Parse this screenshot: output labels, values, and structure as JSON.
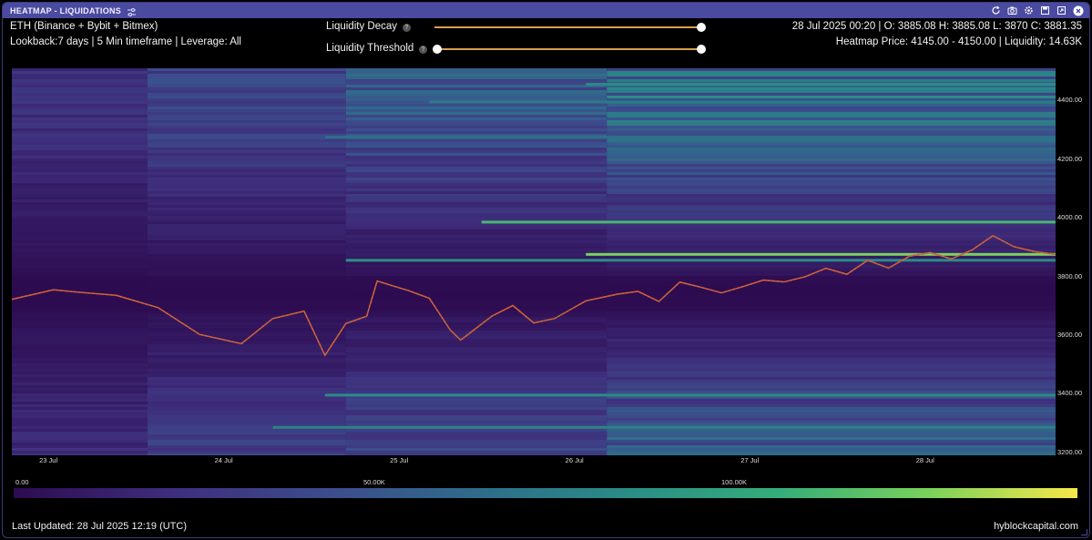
{
  "window": {
    "title": "HEATMAP - LIQUIDATIONS",
    "settings_icon": "sliders-icon",
    "toolbar_icons": [
      "refresh-icon",
      "camera-icon",
      "gear-icon",
      "save-icon",
      "expand-icon",
      "close-icon"
    ]
  },
  "info": {
    "exchanges": "ETH (Binance + Bybit + Bitmex)",
    "lookback": "Lookback:7 days | 5 Min timeframe | Leverage: All",
    "ohlc": "28 Jul 2025 00:20 | O: 3885.08 H: 3885.08 L: 3870 C: 3881.35",
    "heatmap_price": "Heatmap Price: 4145.00 - 4150.00 | Liquidity: 14.63K"
  },
  "controls": {
    "decay": {
      "label": "Liquidity Decay",
      "help": "?",
      "value": 1.0
    },
    "threshold": {
      "label": "Liquidity Threshold",
      "help": "?",
      "min": 0.0,
      "max": 1.0
    }
  },
  "chart_data": {
    "type": "heatmap",
    "y_ticks": [
      "4400.00",
      "4200.00",
      "4000.00",
      "3800.00",
      "3600.00",
      "3400.00",
      "3200.00"
    ],
    "x_ticks": [
      "23 Jul",
      "24 Jul",
      "25 Jul",
      "26 Jul",
      "27 Jul",
      "28 Jul"
    ],
    "ylim": [
      3190,
      4510
    ],
    "price_series": [
      [
        0,
        3720
      ],
      [
        0.04,
        3760
      ],
      [
        0.06,
        3745
      ],
      [
        0.1,
        3730
      ],
      [
        0.14,
        3690
      ],
      [
        0.18,
        3600
      ],
      [
        0.22,
        3570
      ],
      [
        0.25,
        3660
      ],
      [
        0.28,
        3680
      ],
      [
        0.3,
        3530
      ],
      [
        0.32,
        3640
      ],
      [
        0.34,
        3670
      ],
      [
        0.35,
        3780
      ],
      [
        0.38,
        3750
      ],
      [
        0.4,
        3720
      ],
      [
        0.42,
        3620
      ],
      [
        0.43,
        3580
      ],
      [
        0.46,
        3660
      ],
      [
        0.48,
        3700
      ],
      [
        0.5,
        3640
      ],
      [
        0.52,
        3660
      ],
      [
        0.55,
        3720
      ],
      [
        0.58,
        3740
      ],
      [
        0.6,
        3750
      ],
      [
        0.62,
        3720
      ],
      [
        0.64,
        3780
      ],
      [
        0.66,
        3760
      ],
      [
        0.68,
        3740
      ],
      [
        0.7,
        3770
      ],
      [
        0.72,
        3790
      ],
      [
        0.74,
        3780
      ],
      [
        0.76,
        3800
      ],
      [
        0.78,
        3830
      ],
      [
        0.8,
        3810
      ],
      [
        0.82,
        3860
      ],
      [
        0.84,
        3830
      ],
      [
        0.86,
        3870
      ],
      [
        0.88,
        3880
      ],
      [
        0.9,
        3860
      ],
      [
        0.92,
        3890
      ],
      [
        0.94,
        3940
      ],
      [
        0.96,
        3900
      ],
      [
        0.98,
        3880
      ],
      [
        1.0,
        3870
      ]
    ],
    "colorbar": {
      "labels": [
        "0.00",
        "50.00K",
        "100.00K"
      ]
    }
  },
  "footer": {
    "last_updated": "Last Updated: 28 Jul 2025 12:19 (UTC)",
    "brand": "hyblockcapital.com"
  }
}
